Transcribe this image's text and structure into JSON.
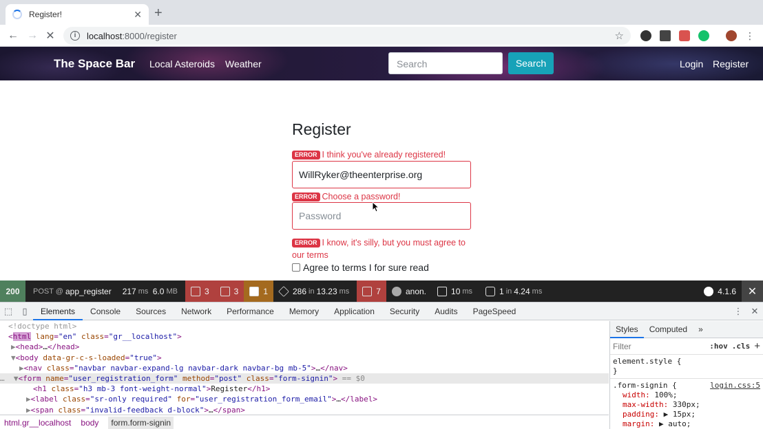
{
  "browser": {
    "tab_title": "Register!",
    "tab_close": "✕",
    "new_tab": "+",
    "url_host": "localhost",
    "url_path": ":8000/register"
  },
  "navbar": {
    "brand": "The Space Bar",
    "links": [
      "Local Asteroids",
      "Weather"
    ],
    "search_placeholder": "Search",
    "search_button": "Search",
    "right_links": [
      "Login",
      "Register"
    ]
  },
  "form": {
    "heading": "Register",
    "error_badge": "ERROR",
    "email_error": "I think you've already registered!",
    "email_value": "WillRyker@theenterprise.org",
    "password_error": "Choose a password!",
    "password_placeholder": "Password",
    "terms_error_line1": "I know, it's silly, but you must agree to",
    "terms_error_line2": "our terms",
    "terms_label": "Agree to terms I for sure read",
    "error_color": "#dc3545"
  },
  "symfony_toolbar": {
    "status": "200",
    "method_route_prefix": "POST @",
    "route": "app_register",
    "time": "217",
    "time_unit": "ms",
    "memory": "6.0",
    "memory_unit": "MB",
    "forms_count": "3",
    "validator_count": "3",
    "warnings_count": "1",
    "twig_count": "286",
    "twig_in": "in",
    "twig_time": "13.23",
    "twig_unit": "ms",
    "translation_count": "7",
    "user": "anon.",
    "events_time": "10",
    "events_unit": "ms",
    "db_queries": "1",
    "db_in": "in",
    "db_time": "4.24",
    "db_unit": "ms",
    "version": "4.1.6"
  },
  "devtools": {
    "tabs": [
      "Elements",
      "Console",
      "Sources",
      "Network",
      "Performance",
      "Memory",
      "Application",
      "Security",
      "Audits",
      "PageSpeed"
    ],
    "active_tab": "Elements",
    "styles_tabs": [
      "Styles",
      "Computed"
    ],
    "filter_placeholder": "Filter",
    "hov": ":hov",
    "cls": ".cls",
    "breadcrumbs": [
      "html.gr__localhost",
      "body",
      "form.form-signin"
    ],
    "element_style": "element.style {",
    "element_style_close": "}",
    "rule_selector": ".form-signin {",
    "rule_source": "login.css:5",
    "rule_props": [
      {
        "name": "width:",
        "value": "100%;"
      },
      {
        "name": "max-width:",
        "value": "330px;"
      },
      {
        "name": "padding:",
        "value": "▶ 15px;"
      },
      {
        "name": "margin:",
        "value": "▶ auto;"
      }
    ]
  }
}
